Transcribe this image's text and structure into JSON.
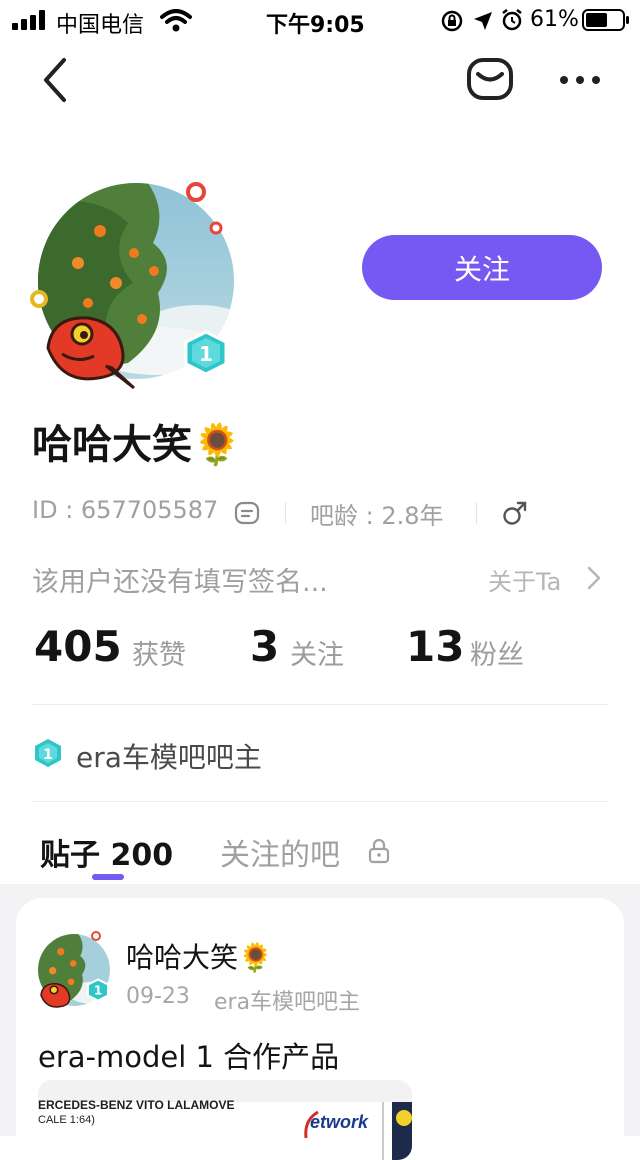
{
  "status_bar": {
    "carrier": "中国电信",
    "time": "下午9:05",
    "battery": "61%"
  },
  "nav": {
    "back_icon": "chevron-left-icon",
    "message_icon": "envelope-icon",
    "more_icon": "more-icon"
  },
  "profile": {
    "name": "哈哈大笑🌻",
    "follow_label": "关注",
    "level": "1",
    "id_text": "ID : 657705587",
    "age_text": "吧龄 : 2.8年",
    "signature": "该用户还没有填写签名...",
    "about_label": "关于Ta",
    "stats": [
      {
        "value": "405",
        "label": "获赞"
      },
      {
        "value": "3",
        "label": "关注"
      },
      {
        "value": "13",
        "label": "粉丝"
      }
    ],
    "badge_level": "1",
    "badge_text": "era车模吧吧主"
  },
  "tabs": [
    {
      "label": "贴子 200"
    },
    {
      "label": "关注的吧"
    }
  ],
  "post": {
    "author": "哈哈大笑🌻",
    "date": "09-23",
    "forum": "era车模吧吧主",
    "title": "era-model 1 合作产品",
    "image_text_left": "ERCEDES-BENZ VITO LALAMOVE",
    "image_text_scale": "CALE 1:64)",
    "image_text_right": "etwork"
  },
  "colors": {
    "accent": "#7559f2",
    "badge": "#2ec6c9",
    "text_primary": "#141414",
    "text_secondary": "#a0a0a0"
  }
}
